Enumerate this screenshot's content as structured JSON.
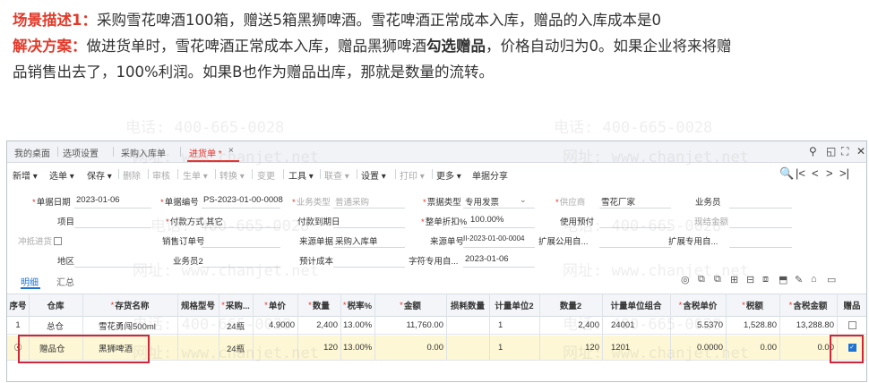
{
  "desc": {
    "line1_label": "场景描述1：",
    "line1_text": "采购雪花啤酒100箱，赠送5箱黑狮啤酒。雪花啤酒正常成本入库，赠品的入库成本是0",
    "line2_label": "解决方案：",
    "line2_text_a": "做进货单时，雪花啤酒正常成本入库，赠品黑狮啤酒",
    "line2_bold": "勾选赠品",
    "line2_text_b": "，价格自动归为0。如果企业将来将赠",
    "line3_text": "品销售出去了，100%利润。如果B也作为赠品出库，那就是数量的流转。"
  },
  "watermark": {
    "phone": "电话: 400-665-0028",
    "site": "网址: www.chanjet.net"
  },
  "tabs": [
    {
      "label": "我的桌面"
    },
    {
      "label": "选项设置"
    },
    {
      "label": "采购入库单"
    },
    {
      "label": "进货单 *",
      "close": "×"
    }
  ],
  "window_controls": {
    "search": "⚲",
    "restore": "◱",
    "max": "⛶",
    "close": "✕"
  },
  "toolbar": {
    "items": [
      "新增",
      "选单",
      "保存",
      "删除",
      "审核",
      "生单",
      "转换",
      "变更",
      "工具",
      "联查",
      "设置",
      "打印",
      "更多",
      "单据分享"
    ],
    "nav": [
      "🔍",
      "|<",
      "<",
      ">",
      ">|"
    ]
  },
  "form": {
    "doc_date_label": "单据日期",
    "doc_date": "2023-01-06",
    "doc_no_label": "单据编号",
    "doc_no": "PS-2023-01-00-0008",
    "biz_type_label": "业务类型",
    "biz_type": "普通采购",
    "invoice_type_label": "票据类型",
    "invoice_type": "专用发票",
    "supplier_label": "供应商",
    "supplier": "雪花厂家",
    "salesman_label": "业务员",
    "project_label": "项目",
    "pay_method_label": "付款方式",
    "pay_method": "其它",
    "pay_due_label": "付款到期日",
    "discount_label": "整单折扣%",
    "discount": "100.00%",
    "prepay_label": "使用预付",
    "settle_amt_label": "现结金额",
    "offset_label": "冲抵进货",
    "order_no_label": "销售订单号",
    "src_type_label": "来源单据",
    "src_type": "采购入库单",
    "src_no_label": "来源单号",
    "src_no": "II-2023-01-00-0004",
    "ext_public_label": "扩展公用自...",
    "ext_private_label": "扩展专用自...",
    "region_label": "地区",
    "salesman2_label": "业务员2",
    "est_cost_label": "预计成本",
    "char_private_label": "字符专用自...",
    "char_private": "2023-01-06"
  },
  "subtabs": {
    "detail": "明细",
    "summary": "汇总",
    "icons": [
      "◎",
      "⧉",
      "⧉",
      "⊞",
      "⊟",
      "⧈",
      "⬒",
      "✎",
      "⌂",
      "▭"
    ]
  },
  "grid": {
    "headers": [
      "序号",
      "仓库",
      "存货名称",
      "规格型号",
      "采购...",
      "单价",
      "数量",
      "税率%",
      "金额",
      "损耗数量",
      "计量单位2",
      "数量2",
      "计量单位组合",
      "含税单价",
      "税额",
      "含税金额",
      "赠品"
    ],
    "rows": [
      {
        "seq": "1",
        "warehouse": "总仓",
        "item": "雪花勇闯500ml",
        "spec": "",
        "unit": "24瓶",
        "price": "4.9000",
        "qty": "2,400",
        "tax_rate": "13.00%",
        "amount": "11,760.00",
        "loss": "",
        "unit2": "1",
        "qty2": "2,400",
        "unit_combo": "24001",
        "tax_price": "5.5370",
        "tax_amt": "1,528.80",
        "tax_total": "13,288.80",
        "gift": false
      },
      {
        "seq": "☉",
        "warehouse": "赠品仓",
        "item": "黑狮啤酒",
        "spec": "",
        "unit": "24瓶",
        "price": "",
        "qty": "120",
        "tax_rate": "13.00%",
        "amount": "0.00",
        "loss": "",
        "unit2": "1",
        "qty2": "120",
        "unit_combo": "1201",
        "tax_price": "0.0000",
        "tax_amt": "0.00",
        "tax_total": "0.00",
        "gift": true
      }
    ]
  }
}
